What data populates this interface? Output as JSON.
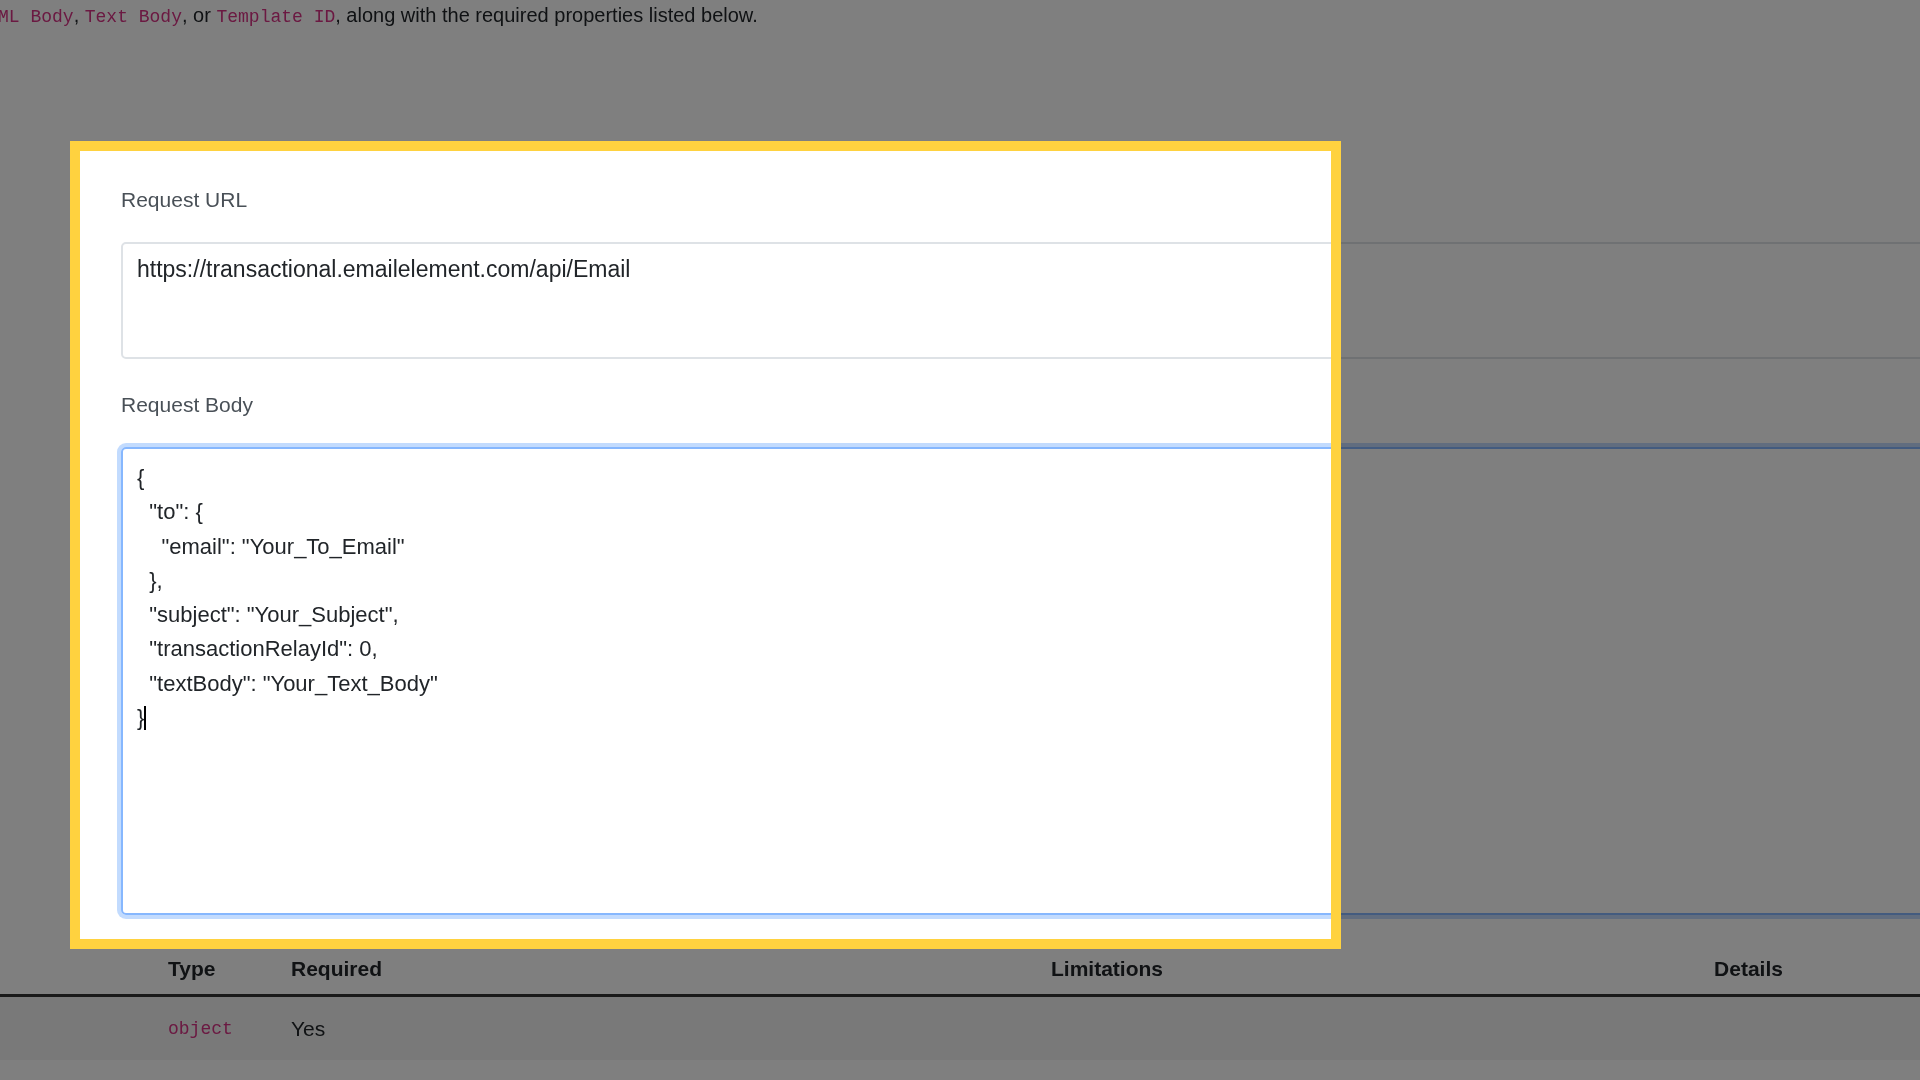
{
  "intro": [
    {
      "kind": "code",
      "text": "ML Body"
    },
    {
      "kind": "plain",
      "text": ", "
    },
    {
      "kind": "code",
      "text": "Text Body"
    },
    {
      "kind": "plain",
      "text": ", or "
    },
    {
      "kind": "code",
      "text": "Template ID"
    },
    {
      "kind": "plain",
      "text": ", along with the required properties listed below."
    }
  ],
  "request_url": {
    "label": "Request URL",
    "value": "https://transactional.emailelement.com/api/Email"
  },
  "request_body": {
    "label": "Request Body",
    "focused": true,
    "lines": [
      "{",
      "  \"to\": {",
      "    \"email\": \"Your_To_Email\"",
      "  },",
      "  \"subject\": \"Your_Subject\",",
      "  \"transactionRelayId\": 0,",
      "  \"textBody\": \"Your_Text_Body\"",
      "}"
    ]
  },
  "table": {
    "columns": [
      "Type",
      "Required",
      "Limitations",
      "Details"
    ],
    "rows": [
      {
        "cells": [
          "object",
          "Yes"
        ]
      }
    ]
  }
}
